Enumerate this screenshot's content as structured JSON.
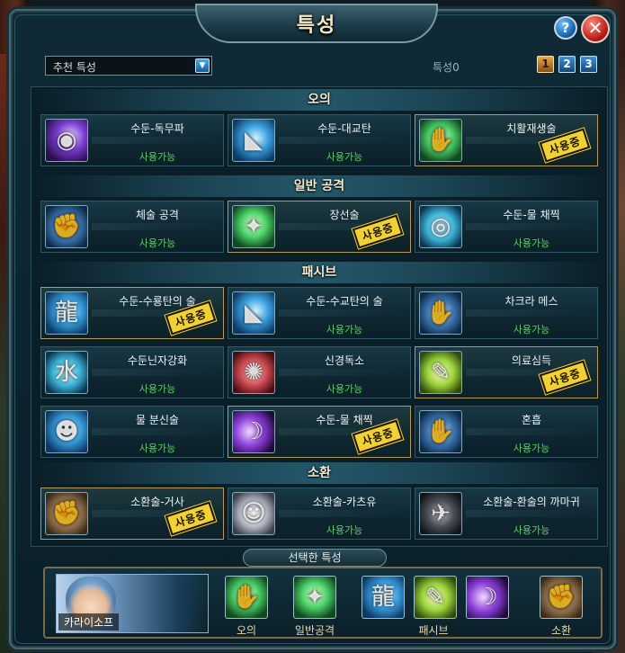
{
  "window": {
    "title": "특성"
  },
  "toolbar": {
    "preset_value": "추천 특성",
    "points_label": "특성0",
    "pages": [
      "1",
      "2",
      "3"
    ],
    "active_page": "1"
  },
  "sections": [
    {
      "title": "오의",
      "cards": [
        {
          "name": "수둔-독무파",
          "status": "사용가능",
          "icon": "purple-ninjutsu-icon",
          "used": false
        },
        {
          "name": "수둔-대교탄",
          "status": "사용가능",
          "icon": "shark-water-icon",
          "used": false
        },
        {
          "name": "치활재생술",
          "status": "",
          "icon": "green-healing-hand-icon",
          "used": true
        }
      ]
    },
    {
      "title": "일반 공격",
      "cards": [
        {
          "name": "체술 공격",
          "status": "사용가능",
          "icon": "fist-icon",
          "used": false
        },
        {
          "name": "장선술",
          "status": "",
          "icon": "green-palm-icon",
          "used": true
        },
        {
          "name": "수둔-물 채찍",
          "status": "사용가능",
          "icon": "water-whip-icon",
          "used": false
        }
      ]
    },
    {
      "title": "패시브",
      "cards": [
        {
          "name": "수둔-수룡탄의 술",
          "status": "",
          "icon": "water-dragon-icon",
          "used": true
        },
        {
          "name": "수둔-수교탄의 술",
          "status": "사용가능",
          "icon": "water-shark-icon",
          "used": false
        },
        {
          "name": "차크라 메스",
          "status": "사용가능",
          "icon": "chakra-scalpel-hand-icon",
          "used": false
        },
        {
          "name": "수둔닌자강화",
          "status": "사용가능",
          "icon": "water-kanji-icon",
          "used": false
        },
        {
          "name": "신경독소",
          "status": "사용가능",
          "icon": "brain-toxin-icon",
          "used": false
        },
        {
          "name": "의료심득",
          "status": "",
          "icon": "medical-scalpel-icon",
          "used": true
        },
        {
          "name": "물 분신술",
          "status": "사용가능",
          "icon": "water-clone-icon",
          "used": false
        },
        {
          "name": "수둔-물 채찍",
          "status": "",
          "icon": "purple-blade-icon",
          "used": true
        },
        {
          "name": "혼흡",
          "status": "사용가능",
          "icon": "glowing-hand-icon",
          "used": false
        }
      ]
    },
    {
      "title": "소환",
      "cards": [
        {
          "name": "소환술-거사",
          "status": "",
          "icon": "summon-beast-icon",
          "used": true
        },
        {
          "name": "소환술-카츠유",
          "status": "사용가능",
          "icon": "slug-katsuyu-icon",
          "used": false
        },
        {
          "name": "소환술-환술의 까마귀",
          "status": "사용가능",
          "icon": "crow-icon",
          "used": false
        }
      ]
    }
  ],
  "used_stamp": "사용중",
  "selected": {
    "title": "선택한 특성",
    "character_name": "카라이소프",
    "labels": {
      "ougi": "오의",
      "normal": "일반공격",
      "passive": "패시브",
      "summon": "소환"
    }
  },
  "colors": {
    "used_stamp": "#f2d233",
    "available_text": "#5fcf6e",
    "header_text": "#f4ecd2"
  }
}
